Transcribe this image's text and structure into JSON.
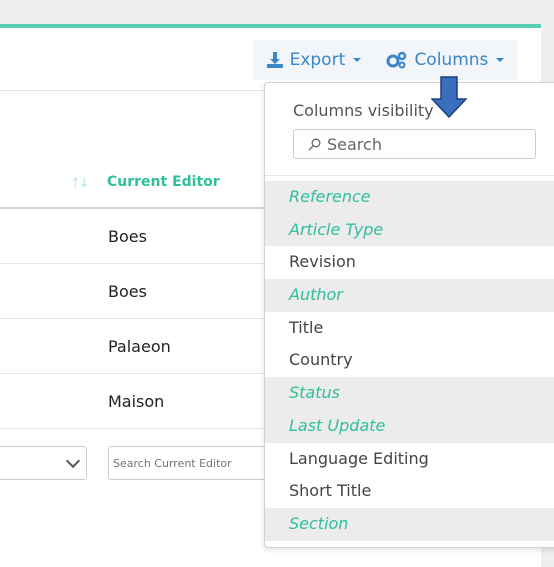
{
  "toolbar": {
    "export_label": "Export",
    "columns_label": "Columns"
  },
  "table": {
    "sort_icon": "↑↓",
    "header": "Current Editor",
    "rows": [
      "Boes",
      "Boes",
      "Palaeon",
      "Maison"
    ],
    "filter_placeholder": "Search Current Editor"
  },
  "columns_menu": {
    "title": "Columns visibility",
    "search_placeholder": "Search",
    "items": [
      {
        "label": "Reference",
        "hidden": true
      },
      {
        "label": "Article Type",
        "hidden": true
      },
      {
        "label": "Revision",
        "hidden": false
      },
      {
        "label": "Author",
        "hidden": true
      },
      {
        "label": "Title",
        "hidden": false
      },
      {
        "label": "Country",
        "hidden": false
      },
      {
        "label": "Status",
        "hidden": true
      },
      {
        "label": "Last Update",
        "hidden": true
      },
      {
        "label": "Language Editing",
        "hidden": false
      },
      {
        "label": "Short Title",
        "hidden": false
      },
      {
        "label": "Section",
        "hidden": true
      }
    ]
  },
  "colors": {
    "accent": "#54d0b4",
    "link": "#3a86c8",
    "hidden_text": "#2fbf9a",
    "arrow_fill": "#3a6fbf"
  },
  "icons": {
    "export": "download-icon",
    "columns": "gears-icon",
    "annotation": "down-arrow-icon"
  }
}
